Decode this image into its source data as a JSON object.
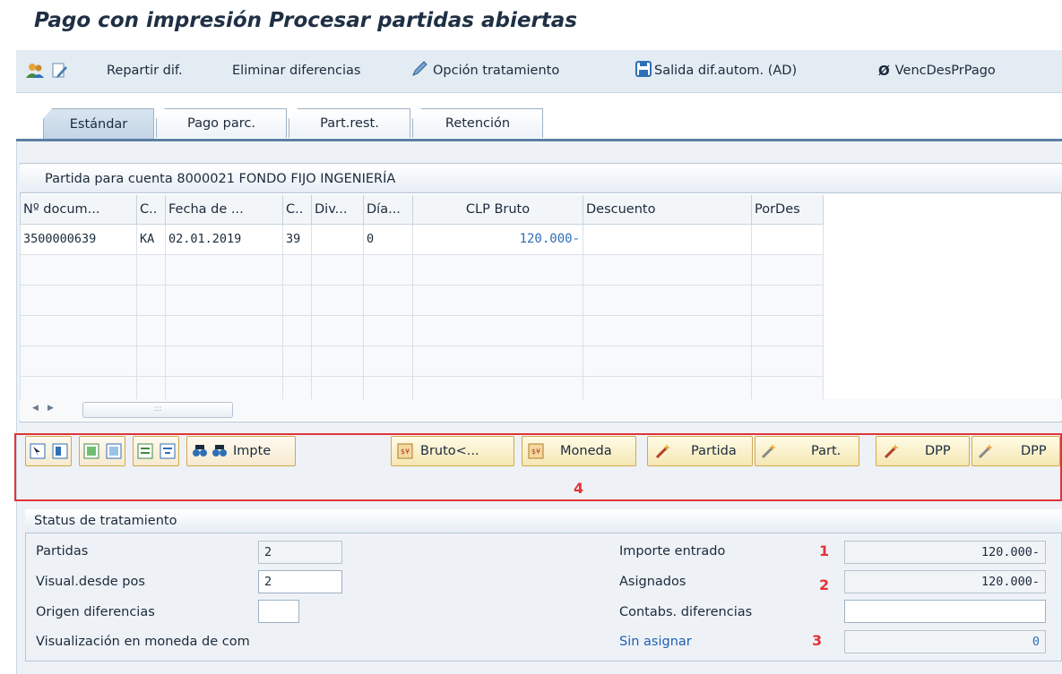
{
  "title": "Pago con impresión Procesar partidas abiertas",
  "toolbar": {
    "repartir": "Repartir dif.",
    "eliminar": "Eliminar diferencias",
    "opcion": "Opción tratamiento",
    "salida": "Salida dif.autom. (AD)",
    "venc": "VencDesPrPago"
  },
  "tabs": [
    "Estándar",
    "Pago parc.",
    "Part.rest.",
    "Retención"
  ],
  "grid": {
    "caption": "Partida para cuenta 8000021 FONDO FIJO INGENIERÍA",
    "columns": [
      "Nº docum...",
      "C..",
      "Fecha de ...",
      "C..",
      "Div...",
      "Día...",
      "CLP Bruto",
      "Descuento",
      "PorDes"
    ],
    "rows": [
      [
        "3500000639",
        "KA",
        "02.01.2019",
        "39",
        "",
        "0",
        "120.000-",
        "",
        ""
      ]
    ]
  },
  "scroll_thumb": ":::",
  "buttons": {
    "impte": "Impte",
    "bruto": "Bruto<...",
    "moneda": "Moneda",
    "partida": "Partida",
    "part": "Part.",
    "dpp1": "DPP",
    "dpp2": "DPP"
  },
  "annotations": {
    "m1": "1",
    "m2": "2",
    "m3": "3",
    "m4": "4"
  },
  "status": {
    "title": "Status de tratamiento",
    "partidas_label": "Partidas",
    "partidas_value": "2",
    "visual_label": "Visual.desde pos",
    "visual_value": "2",
    "origen_label": "Origen diferencias",
    "origen_value": "",
    "moneda_label": "Visualización en moneda de com",
    "importe_label": "Importe entrado",
    "importe_value": "120.000-",
    "asignados_label": "Asignados",
    "asignados_value": "120.000-",
    "contabs_label": "Contabs. diferencias",
    "contabs_value": "",
    "sin_label": "Sin asignar",
    "sin_value": "0"
  },
  "colors": {
    "accent_red": "#e0343a",
    "link_blue": "#1f5fb3",
    "amount_blue": "#2f6fb6",
    "button_border": "#d3a94a"
  }
}
